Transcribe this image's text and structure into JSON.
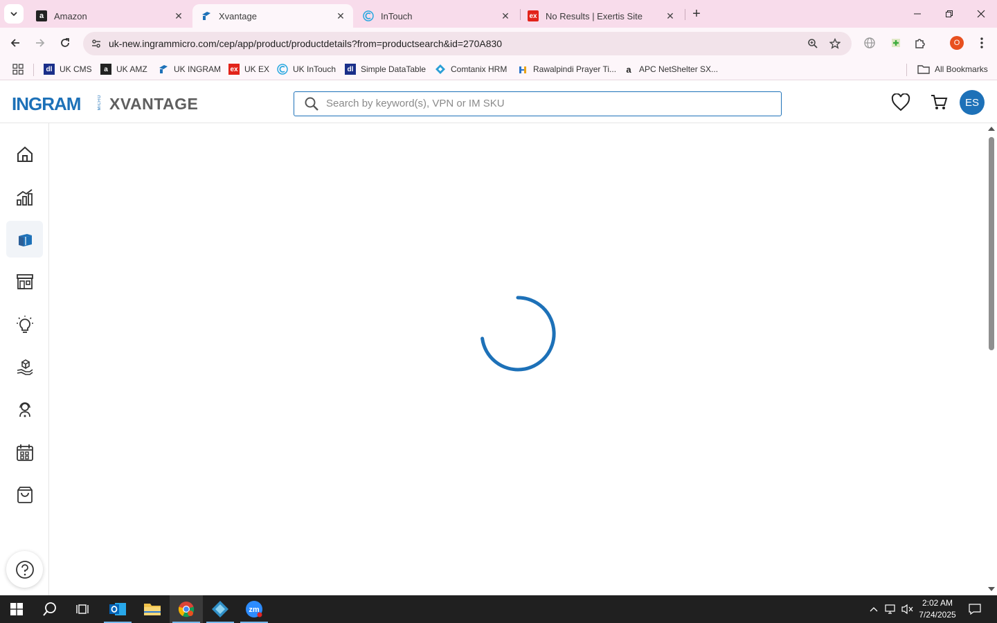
{
  "browser": {
    "tabs": [
      {
        "title": "Amazon",
        "favicon": "amazon-icon",
        "active": false
      },
      {
        "title": "Xvantage",
        "favicon": "ingram-icon",
        "active": true
      },
      {
        "title": "InTouch",
        "favicon": "intouch-icon",
        "active": false
      },
      {
        "title": "No Results | Exertis Site",
        "favicon": "exertis-icon",
        "active": false
      }
    ],
    "url": "uk-new.ingrammicro.com/cep/app/product/productdetails?from=productsearch&id=270A830",
    "profile_initial": "O",
    "bookmarks": [
      {
        "label": "UK CMS",
        "icon": "dl-icon"
      },
      {
        "label": "UK AMZ",
        "icon": "amazon-icon"
      },
      {
        "label": "UK INGRAM",
        "icon": "ingram-icon"
      },
      {
        "label": "UK EX",
        "icon": "exertis-icon"
      },
      {
        "label": "UK InTouch",
        "icon": "intouch-icon"
      },
      {
        "label": "Simple DataTable",
        "icon": "dl-icon"
      },
      {
        "label": "Comtanix HRM",
        "icon": "comtanix-icon"
      },
      {
        "label": "Rawalpindi Prayer Ti...",
        "icon": "prayer-icon"
      },
      {
        "label": "APC NetShelter SX...",
        "icon": "amazon-smile-icon"
      }
    ],
    "all_bookmarks": "All Bookmarks"
  },
  "app": {
    "logo_main": "INGRAM",
    "logo_micro": "MICRO",
    "logo_product": "XVANTAGE",
    "search_placeholder": "Search by keyword(s), VPN or IM SKU",
    "avatar_initials": "ES",
    "nav_items": [
      "home-icon",
      "analytics-icon",
      "products-icon",
      "store-icon",
      "ideas-icon",
      "services-icon",
      "support-icon",
      "calendar-icon",
      "orders-icon"
    ],
    "active_nav": "products-icon",
    "state": "loading"
  },
  "colors": {
    "brand_blue": "#1d71b8",
    "tabstrip": "#f8dceb",
    "toolbar": "#fdf6fa",
    "taskbar": "#202020"
  },
  "taskbar": {
    "time": "2:02 AM",
    "date": "7/24/2025",
    "apps": [
      "windows-start-icon",
      "search-icon",
      "task-view-icon",
      "outlook-icon",
      "file-explorer-icon",
      "chrome-icon",
      "app-diamond-icon",
      "zoom-icon"
    ]
  }
}
